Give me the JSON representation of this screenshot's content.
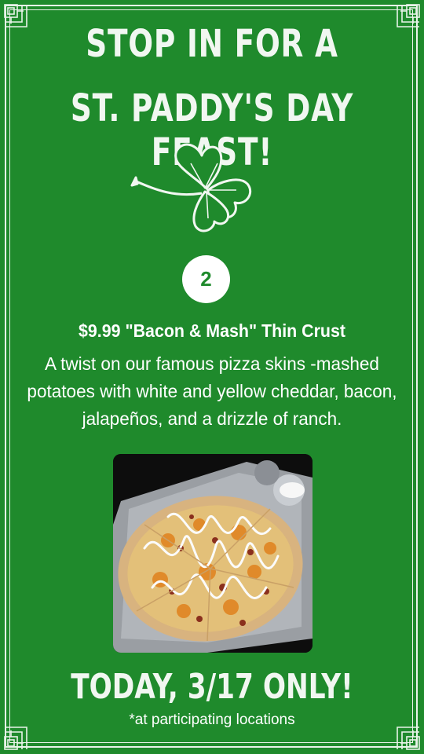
{
  "headline": {
    "line1": "STOP IN FOR A",
    "line2": "ST. PADDY'S DAY FEAST!"
  },
  "badge_number": "2",
  "item": {
    "title": "$9.99 \"Bacon & Mash\" Thin Crust",
    "description": "A twist on our famous pizza skins -mashed potatoes with white and yellow cheddar, bacon, jalapeños, and a drizzle of ranch."
  },
  "footer": {
    "title": "TODAY, 3/17 ONLY!",
    "note": "*at participating locations"
  },
  "icons": [
    "shamrock-icon",
    "corner-ornament"
  ],
  "colors": {
    "background": "#1f8a2c",
    "text": "#ffffff"
  }
}
